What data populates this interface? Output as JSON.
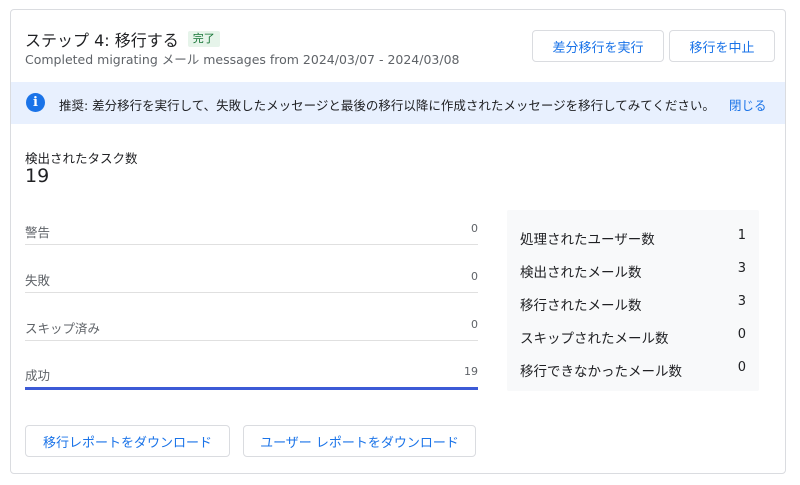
{
  "header": {
    "title": "ステップ 4: 移行する",
    "badge": "完了",
    "subtitle": "Completed migrating メール messages from 2024/03/07 - 2024/03/08",
    "delta_button": "差分移行を実行",
    "stop_button": "移行を中止"
  },
  "banner": {
    "icon": "info-icon",
    "text": "推奨: 差分移行を実行して、失敗したメッセージと最後の移行以降に作成されたメッセージを移行してみてください。",
    "close_label": "閉じる"
  },
  "tasks": {
    "label": "検出されたタスク数",
    "value": "19"
  },
  "stats": [
    {
      "label": "警告",
      "value": "0"
    },
    {
      "label": "失敗",
      "value": "0"
    },
    {
      "label": "スキップ済み",
      "value": "0"
    },
    {
      "label": "成功",
      "value": "19"
    }
  ],
  "summary": [
    {
      "label": "処理されたユーザー数",
      "value": "1"
    },
    {
      "label": "検出されたメール数",
      "value": "3"
    },
    {
      "label": "移行されたメール数",
      "value": "3"
    },
    {
      "label": "スキップされたメール数",
      "value": "0"
    },
    {
      "label": "移行できなかったメール数",
      "value": "0"
    }
  ],
  "actions": {
    "download_migration_report": "移行レポートをダウンロード",
    "download_user_report": "ユーザー レポートをダウンロード"
  },
  "colors": {
    "accent": "#1a73e8",
    "banner_bg": "#e8f0fe",
    "badge_bg": "#e6f4ea",
    "badge_text": "#137333",
    "success_bar": "#3c5ad6"
  }
}
